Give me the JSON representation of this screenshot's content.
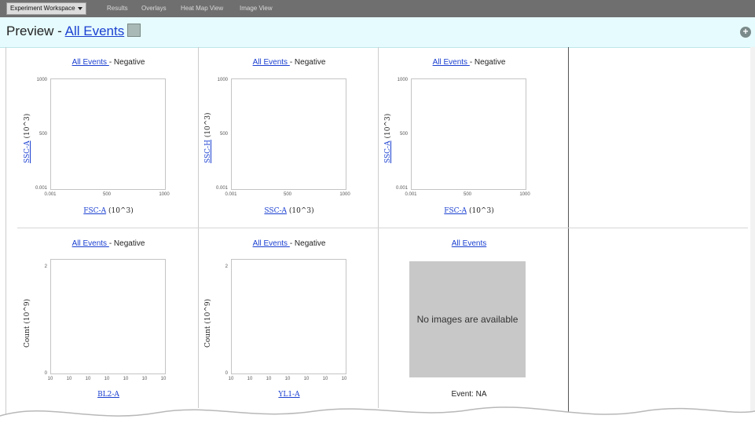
{
  "tabs": [
    {
      "label": "Experiment Workspace",
      "active": true
    },
    {
      "label": "Results",
      "active": false
    },
    {
      "label": "Overlays",
      "active": false
    },
    {
      "label": "Heat Map View",
      "active": false
    },
    {
      "label": "Image View",
      "active": false
    }
  ],
  "header": {
    "prefix": "Preview - ",
    "link": "All Events"
  },
  "cells": [
    {
      "title_link": "All Events ",
      "title_suffix": "- Negative",
      "ylabel_link": "SSC-A",
      "ylabel_unit": " (10^3)",
      "xlabel_link": "FSC-A",
      "xlabel_unit": " (10^3)",
      "yticks": [
        "1000",
        "500",
        "0.001"
      ],
      "xticks": [
        "0.001",
        "500",
        "1000"
      ]
    },
    {
      "title_link": "All Events ",
      "title_suffix": "- Negative",
      "ylabel_link": "SSC-H",
      "ylabel_unit": " (10^3)",
      "xlabel_link": "SSC-A",
      "xlabel_unit": " (10^3)",
      "yticks": [
        "1000",
        "500",
        "0.001"
      ],
      "xticks": [
        "0.001",
        "500",
        "1000"
      ]
    },
    {
      "title_link": "All Events ",
      "title_suffix": "- Negative",
      "ylabel_link": "SSC-A",
      "ylabel_unit": " (10^3)",
      "xlabel_link": "FSC-A",
      "xlabel_unit": " (10^3)",
      "yticks": [
        "1000",
        "500",
        "0.001"
      ],
      "xticks": [
        "0.001",
        "500",
        "1000"
      ]
    },
    {
      "title_link": "All Events ",
      "title_suffix": "- Negative",
      "ylabel_text": "Count (10^9)",
      "xlabel_link": "BL2-A",
      "yticks": [
        "2",
        "0"
      ],
      "xticks": [
        "10",
        "10",
        "10",
        "10",
        "10",
        "10",
        "10"
      ]
    },
    {
      "title_link": "All Events ",
      "title_suffix": "- Negative",
      "ylabel_text": "Count (10^9)",
      "xlabel_link": "YL1-A",
      "yticks": [
        "2",
        "0"
      ],
      "xticks": [
        "10",
        "10",
        "10",
        "10",
        "10",
        "10",
        "10"
      ]
    },
    {
      "title_link": "All Events",
      "no_images": "No images are available",
      "event": "Event: NA"
    }
  ]
}
